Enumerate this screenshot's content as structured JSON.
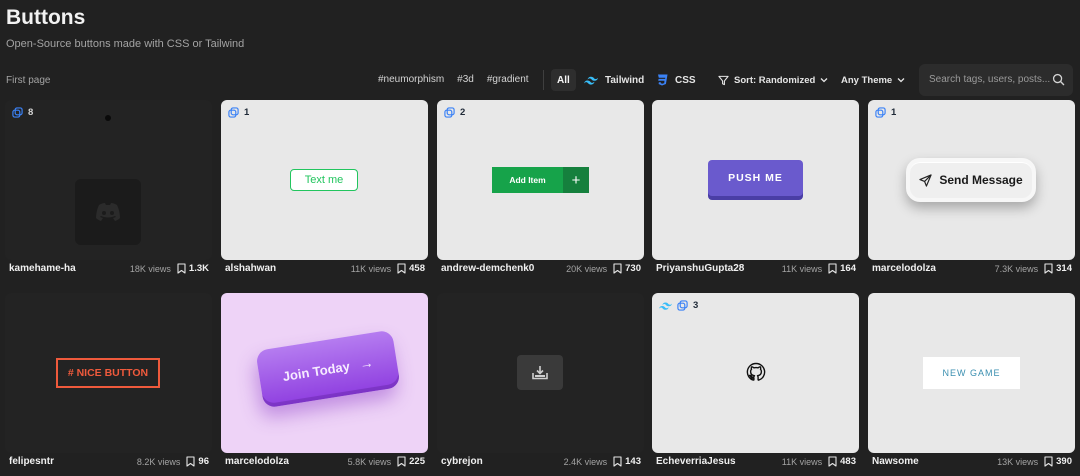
{
  "header": {
    "title": "Buttons",
    "subtitle": "Open-Source buttons made with CSS or Tailwind"
  },
  "toolbar": {
    "first_page": "First page",
    "tags": [
      "#neumorphism",
      "#3d",
      "#gradient"
    ],
    "filter_all": "All",
    "filter_tailwind": "Tailwind",
    "filter_css": "CSS",
    "sort_label": "Sort: Randomized",
    "theme_label": "Any Theme",
    "search_placeholder": "Search tags, users, posts..."
  },
  "colors": {
    "tailwind": "#38bdf8",
    "css": "#3b82f6",
    "background": "#212121"
  },
  "cards": [
    {
      "count": "8",
      "author": "kamehame-ha",
      "views": "18K views",
      "saves": "1.3K"
    },
    {
      "count": "1",
      "author": "alshahwan",
      "views": "11K views",
      "saves": "458",
      "preview_label": "Text me"
    },
    {
      "count": "2",
      "author": "andrew-demchenk0",
      "views": "20K views",
      "saves": "730",
      "preview_label": "Add Item",
      "preview_icon": "+"
    },
    {
      "author": "PriyanshuGupta28",
      "views": "11K views",
      "saves": "164",
      "preview_label": "PUSH ME"
    },
    {
      "count": "1",
      "author": "marcelodolza",
      "views": "7.3K views",
      "saves": "314",
      "preview_label": "Send Message"
    },
    {
      "author": "felipesntr",
      "views": "8.2K views",
      "saves": "96",
      "preview_label": "# NICE BUTTON"
    },
    {
      "author": "marcelodolza",
      "views": "5.8K views",
      "saves": "225",
      "preview_label": "Join Today",
      "preview_icon": "→"
    },
    {
      "author": "cybrejon",
      "views": "2.4K views",
      "saves": "143"
    },
    {
      "count": "3",
      "author": "EcheverriaJesus",
      "views": "11K views",
      "saves": "483"
    },
    {
      "author": "Nawsome",
      "views": "13K views",
      "saves": "390",
      "preview_label": "NEW GAME"
    }
  ]
}
